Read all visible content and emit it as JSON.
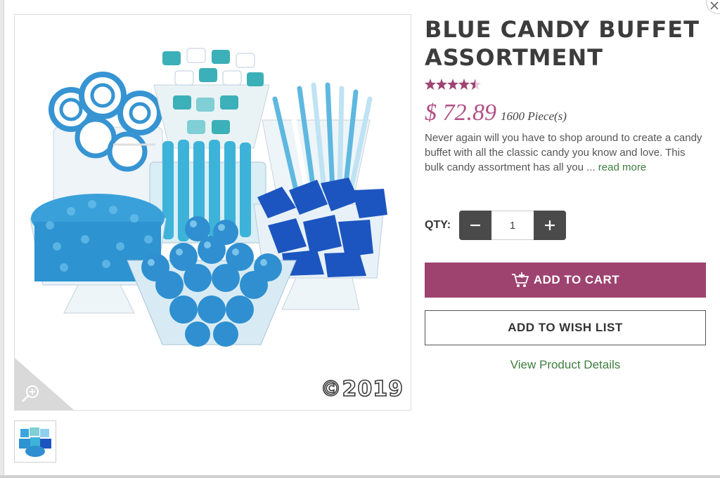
{
  "product": {
    "title": "BLUE CANDY BUFFET ASSORTMENT",
    "rating": 4.5,
    "rating_max": 5,
    "price": "$ 72.89",
    "quantity_info": "1600 Piece(s)",
    "description": "Never again will you have to shop around to create a candy buffet with all the classic candy you know and love. This bulk candy assortment has all you ... ",
    "read_more": "read more",
    "image_watermark": "©2019"
  },
  "quantity": {
    "label": "QTY:",
    "value": "1",
    "minus": "−",
    "plus": "+"
  },
  "actions": {
    "add_to_cart": "ADD TO CART",
    "add_to_wish_list": "ADD TO WISH LIST",
    "view_details": "View Product Details"
  },
  "colors": {
    "accent": "#9e4370",
    "price": "#b14f84",
    "link": "#3f7d3f",
    "stepper": "#4a4a4a"
  }
}
